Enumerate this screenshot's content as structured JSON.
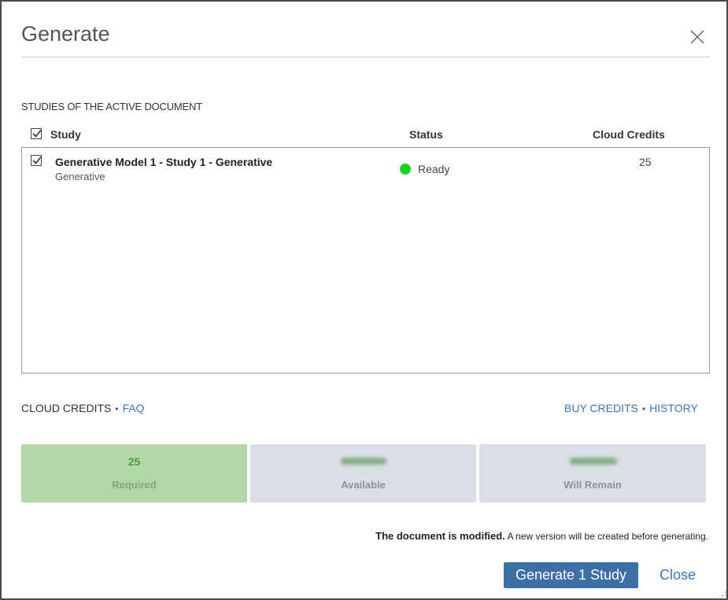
{
  "dialog": {
    "title": "Generate",
    "close_icon": "close-icon"
  },
  "studies": {
    "section_label": "STUDIES OF THE ACTIVE DOCUMENT",
    "columns": {
      "study": "Study",
      "status": "Status",
      "credits": "Cloud Credits"
    },
    "select_all_checked": true,
    "rows": [
      {
        "checked": true,
        "name": "Generative Model 1 - Study 1 - Generative",
        "type": "Generative",
        "status": "Ready",
        "status_color": "#1bd41b",
        "credits": "25"
      }
    ]
  },
  "cloud_credits": {
    "label": "CLOUD CREDITS",
    "faq": "FAQ",
    "buy": "BUY CREDITS",
    "history": "HISTORY",
    "separator": "•",
    "tiles": {
      "required": {
        "value": "25",
        "label": "Required",
        "color": "#b3d6a6"
      },
      "available": {
        "label": "Available",
        "color": "#dadfe5"
      },
      "remain": {
        "label": "Will Remain",
        "color": "#dadfe5"
      }
    }
  },
  "notice": {
    "bold": "The document is modified.",
    "rest": "A new version will be created before generating."
  },
  "footer": {
    "generate_button": "Generate 1 Study",
    "close_button": "Close"
  },
  "colors": {
    "accent": "#3c6fa6",
    "link": "#3a78c0"
  }
}
